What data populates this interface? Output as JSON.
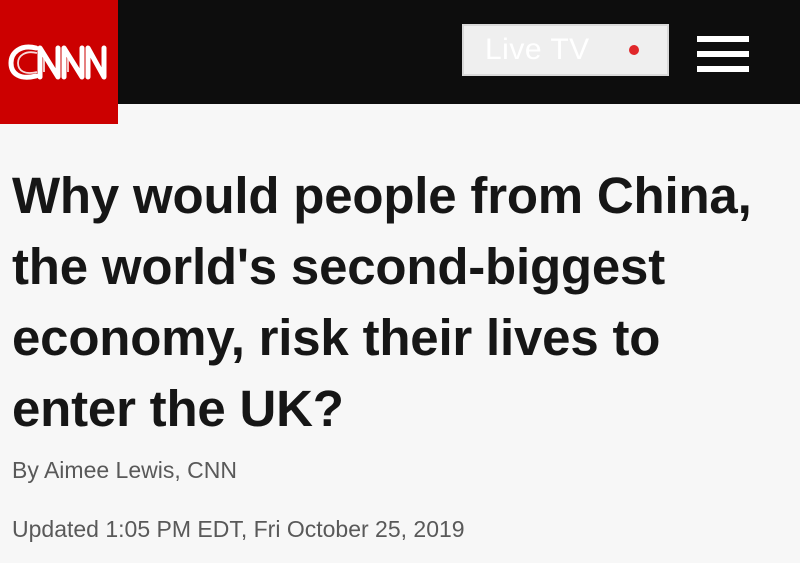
{
  "header": {
    "logo_text": "CNN",
    "live_tv_label": "Live TV",
    "menu_icon": "hamburger-menu-icon",
    "live_indicator_icon": "live-dot-icon"
  },
  "article": {
    "headline": "Why would people from China, the world's second-biggest economy, risk their lives to enter the UK?",
    "byline": "By Aimee Lewis, CNN",
    "updated": "Updated 1:05 PM EDT, Fri October 25, 2019"
  },
  "colors": {
    "brand_red": "#cc0000",
    "header_background": "#0d0d0d",
    "live_dot": "#e0272a",
    "headline_text": "#161616",
    "meta_text": "#595959",
    "page_background": "#f7f7f7"
  }
}
